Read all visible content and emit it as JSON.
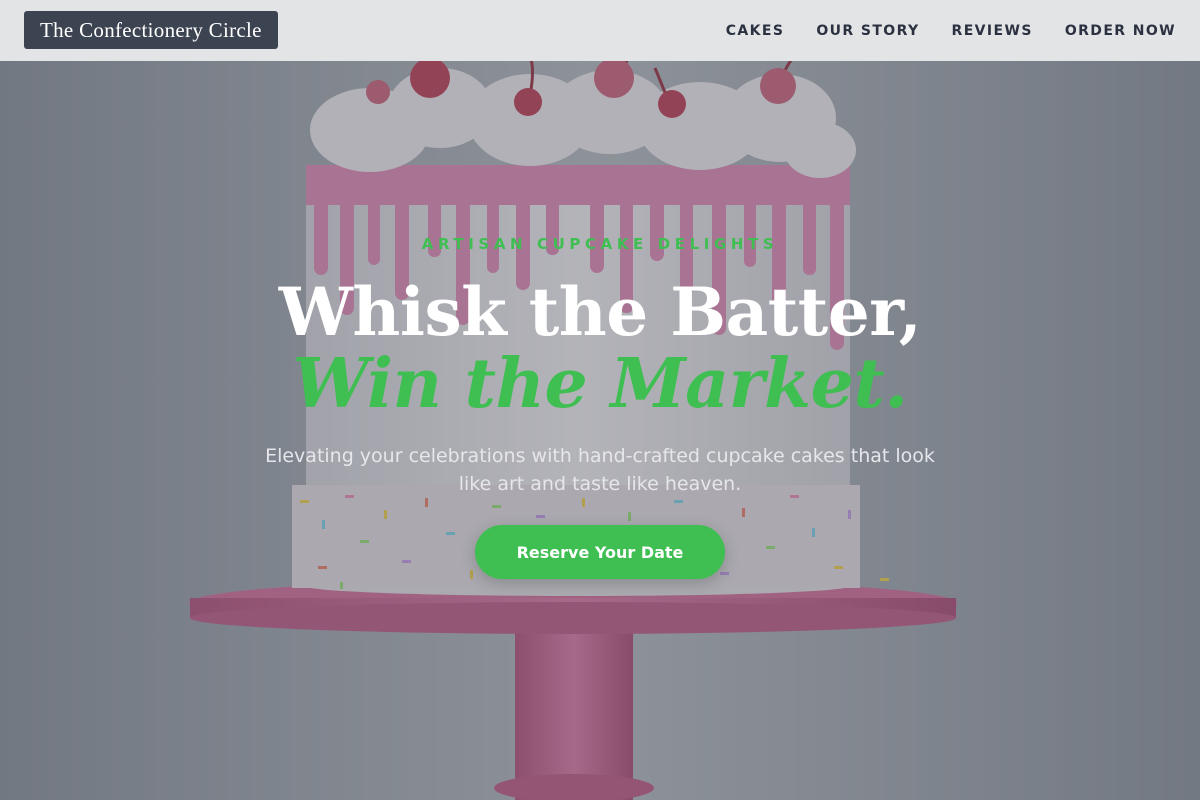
{
  "header": {
    "brand": "The Confectionery Circle",
    "nav": [
      {
        "label": "CAKES"
      },
      {
        "label": "OUR STORY"
      },
      {
        "label": "REVIEWS"
      },
      {
        "label": "ORDER NOW"
      }
    ]
  },
  "hero": {
    "eyebrow": "ARTISAN CUPCAKE DELIGHTS",
    "headline_line1": "Whisk the Batter,",
    "headline_line2": "Win the Market.",
    "subtext": "Elevating your celebrations with hand-crafted cupcake cakes that look like art and taste like heaven.",
    "cta_label": "Reserve Your Date"
  },
  "colors": {
    "accent_green": "#3fbe52",
    "header_bg": "#e3e4e6",
    "brand_bg": "#3d4451",
    "nav_text": "#2b3140",
    "hero_overlay": "#484e5a"
  }
}
